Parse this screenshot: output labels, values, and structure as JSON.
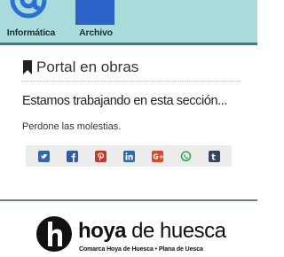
{
  "apps": {
    "informatica": {
      "label": "Informática",
      "icon": "at-sign-icon"
    },
    "archivo": {
      "label": "Archivo",
      "icon": "folder-icon"
    }
  },
  "card": {
    "title": "Portal en obras",
    "title_icon": "bookmark-icon",
    "heading": "Estamos trabajando en esta sección...",
    "message": "Perdone las molestias."
  },
  "share": [
    {
      "name": "twitter",
      "icon": "twitter-icon",
      "color": "#2e6aa8"
    },
    {
      "name": "facebook",
      "icon": "facebook-icon",
      "color": "#2e5aa8"
    },
    {
      "name": "pinterest",
      "icon": "pinterest-icon",
      "color": "#c0392b"
    },
    {
      "name": "linkedin",
      "icon": "linkedin-icon",
      "color": "#2e6aa8"
    },
    {
      "name": "googleplus",
      "icon": "google-plus-icon",
      "color": "#d9482b"
    },
    {
      "name": "whatsapp",
      "icon": "whatsapp-icon",
      "color": "#2aa84a"
    },
    {
      "name": "tumblr",
      "icon": "tumblr-icon",
      "color": "#35465c"
    }
  ],
  "footer": {
    "logo_bold": "hoya",
    "logo_light": " de huesca",
    "subtitle": "Comarca Hoya de Huesca • Plana de Uesca"
  },
  "colors": {
    "topband": "#a9dbdb",
    "accent_blue": "#2c6fd2"
  }
}
